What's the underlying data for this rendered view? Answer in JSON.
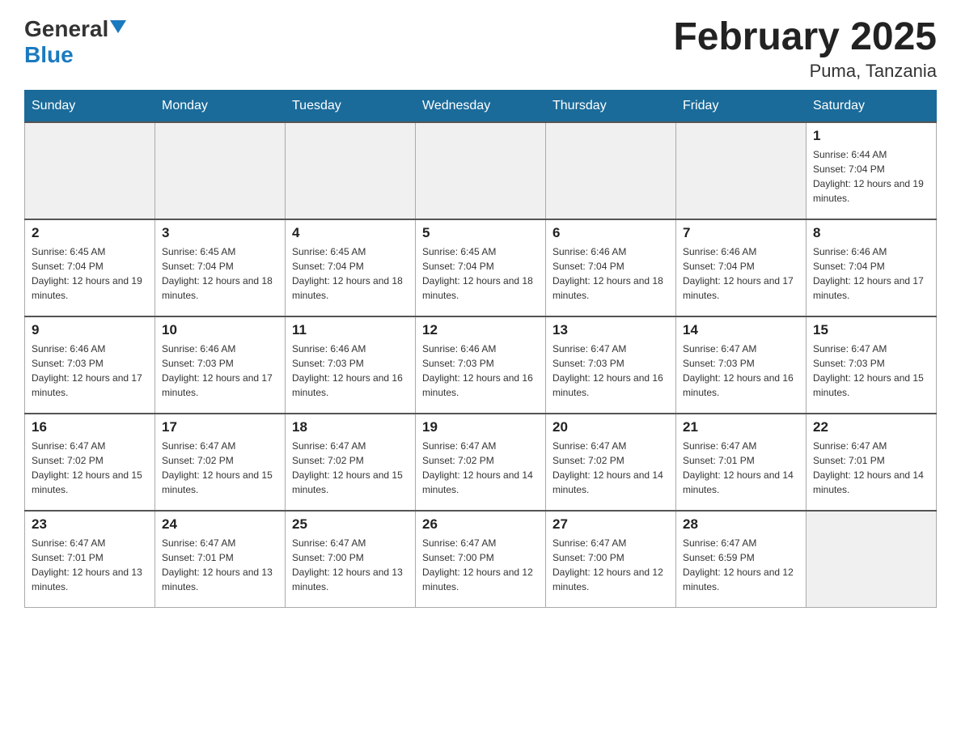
{
  "header": {
    "logo_general": "General",
    "logo_blue": "Blue",
    "month_title": "February 2025",
    "location": "Puma, Tanzania"
  },
  "days_of_week": [
    "Sunday",
    "Monday",
    "Tuesday",
    "Wednesday",
    "Thursday",
    "Friday",
    "Saturday"
  ],
  "weeks": [
    [
      {
        "day": "",
        "empty": true
      },
      {
        "day": "",
        "empty": true
      },
      {
        "day": "",
        "empty": true
      },
      {
        "day": "",
        "empty": true
      },
      {
        "day": "",
        "empty": true
      },
      {
        "day": "",
        "empty": true
      },
      {
        "day": "1",
        "sunrise": "6:44 AM",
        "sunset": "7:04 PM",
        "daylight": "12 hours and 19 minutes."
      }
    ],
    [
      {
        "day": "2",
        "sunrise": "6:45 AM",
        "sunset": "7:04 PM",
        "daylight": "12 hours and 19 minutes."
      },
      {
        "day": "3",
        "sunrise": "6:45 AM",
        "sunset": "7:04 PM",
        "daylight": "12 hours and 18 minutes."
      },
      {
        "day": "4",
        "sunrise": "6:45 AM",
        "sunset": "7:04 PM",
        "daylight": "12 hours and 18 minutes."
      },
      {
        "day": "5",
        "sunrise": "6:45 AM",
        "sunset": "7:04 PM",
        "daylight": "12 hours and 18 minutes."
      },
      {
        "day": "6",
        "sunrise": "6:46 AM",
        "sunset": "7:04 PM",
        "daylight": "12 hours and 18 minutes."
      },
      {
        "day": "7",
        "sunrise": "6:46 AM",
        "sunset": "7:04 PM",
        "daylight": "12 hours and 17 minutes."
      },
      {
        "day": "8",
        "sunrise": "6:46 AM",
        "sunset": "7:04 PM",
        "daylight": "12 hours and 17 minutes."
      }
    ],
    [
      {
        "day": "9",
        "sunrise": "6:46 AM",
        "sunset": "7:03 PM",
        "daylight": "12 hours and 17 minutes."
      },
      {
        "day": "10",
        "sunrise": "6:46 AM",
        "sunset": "7:03 PM",
        "daylight": "12 hours and 17 minutes."
      },
      {
        "day": "11",
        "sunrise": "6:46 AM",
        "sunset": "7:03 PM",
        "daylight": "12 hours and 16 minutes."
      },
      {
        "day": "12",
        "sunrise": "6:46 AM",
        "sunset": "7:03 PM",
        "daylight": "12 hours and 16 minutes."
      },
      {
        "day": "13",
        "sunrise": "6:47 AM",
        "sunset": "7:03 PM",
        "daylight": "12 hours and 16 minutes."
      },
      {
        "day": "14",
        "sunrise": "6:47 AM",
        "sunset": "7:03 PM",
        "daylight": "12 hours and 16 minutes."
      },
      {
        "day": "15",
        "sunrise": "6:47 AM",
        "sunset": "7:03 PM",
        "daylight": "12 hours and 15 minutes."
      }
    ],
    [
      {
        "day": "16",
        "sunrise": "6:47 AM",
        "sunset": "7:02 PM",
        "daylight": "12 hours and 15 minutes."
      },
      {
        "day": "17",
        "sunrise": "6:47 AM",
        "sunset": "7:02 PM",
        "daylight": "12 hours and 15 minutes."
      },
      {
        "day": "18",
        "sunrise": "6:47 AM",
        "sunset": "7:02 PM",
        "daylight": "12 hours and 15 minutes."
      },
      {
        "day": "19",
        "sunrise": "6:47 AM",
        "sunset": "7:02 PM",
        "daylight": "12 hours and 14 minutes."
      },
      {
        "day": "20",
        "sunrise": "6:47 AM",
        "sunset": "7:02 PM",
        "daylight": "12 hours and 14 minutes."
      },
      {
        "day": "21",
        "sunrise": "6:47 AM",
        "sunset": "7:01 PM",
        "daylight": "12 hours and 14 minutes."
      },
      {
        "day": "22",
        "sunrise": "6:47 AM",
        "sunset": "7:01 PM",
        "daylight": "12 hours and 14 minutes."
      }
    ],
    [
      {
        "day": "23",
        "sunrise": "6:47 AM",
        "sunset": "7:01 PM",
        "daylight": "12 hours and 13 minutes."
      },
      {
        "day": "24",
        "sunrise": "6:47 AM",
        "sunset": "7:01 PM",
        "daylight": "12 hours and 13 minutes."
      },
      {
        "day": "25",
        "sunrise": "6:47 AM",
        "sunset": "7:00 PM",
        "daylight": "12 hours and 13 minutes."
      },
      {
        "day": "26",
        "sunrise": "6:47 AM",
        "sunset": "7:00 PM",
        "daylight": "12 hours and 12 minutes."
      },
      {
        "day": "27",
        "sunrise": "6:47 AM",
        "sunset": "7:00 PM",
        "daylight": "12 hours and 12 minutes."
      },
      {
        "day": "28",
        "sunrise": "6:47 AM",
        "sunset": "6:59 PM",
        "daylight": "12 hours and 12 minutes."
      },
      {
        "day": "",
        "empty": true
      }
    ]
  ]
}
